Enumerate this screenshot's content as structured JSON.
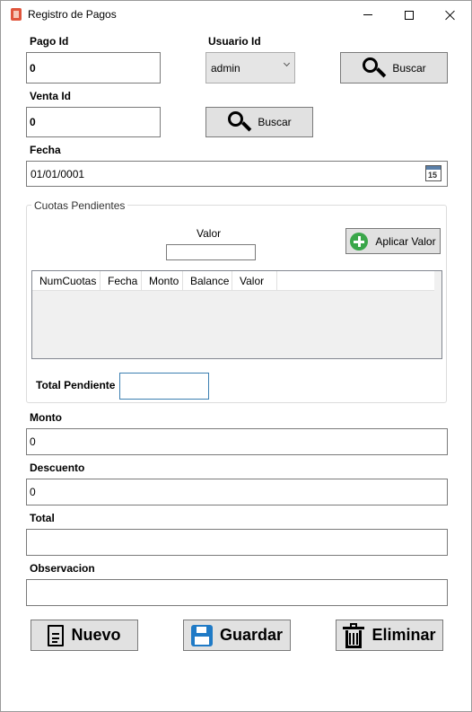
{
  "window": {
    "title": "Registro de Pagos",
    "icon": "app-icon"
  },
  "form": {
    "pago_id": {
      "label": "Pago Id",
      "value": "0"
    },
    "usuario_id": {
      "label": "Usuario Id",
      "selected": "admin"
    },
    "buscar_top": {
      "label": "Buscar",
      "icon": "search-icon"
    },
    "venta_id": {
      "label": "Venta Id",
      "value": "0"
    },
    "buscar_venta": {
      "label": "Buscar",
      "icon": "search-icon"
    },
    "fecha": {
      "label": "Fecha",
      "value": "01/01/0001",
      "icon_day": "15"
    }
  },
  "cuotas": {
    "group_title": "Cuotas Pendientes",
    "valor_label": "Valor",
    "valor_value": "",
    "aplicar_label": "Aplicar Valor",
    "columns": [
      "NumCuotas",
      "Fecha",
      "Monto",
      "Balance",
      "Valor"
    ],
    "rows": [],
    "total_label": "Total Pendiente",
    "total_value": ""
  },
  "monto": {
    "label": "Monto",
    "value": "0"
  },
  "descuento": {
    "label": "Descuento",
    "value": "0"
  },
  "total": {
    "label": "Total",
    "value": ""
  },
  "observacion": {
    "label": "Observacion",
    "value": ""
  },
  "actions": {
    "nuevo": "Nuevo",
    "guardar": "Guardar",
    "eliminar": "Eliminar"
  },
  "colors": {
    "button_bg": "#e1e1e1",
    "accent_green": "#3aa64a",
    "accent_blue": "#1f7ac6"
  }
}
